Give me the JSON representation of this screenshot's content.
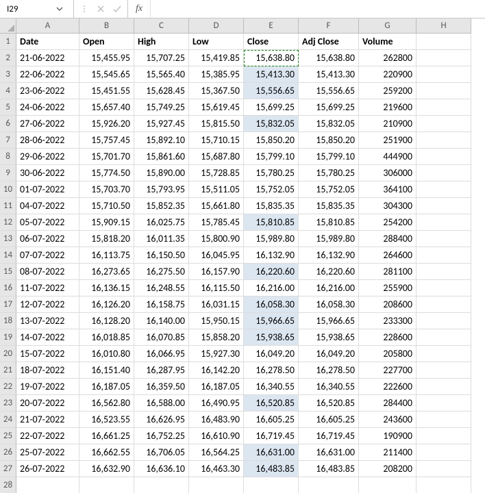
{
  "formula_bar": {
    "name_box_value": "I29",
    "fx_label": "fx",
    "formula_value": ""
  },
  "columns": [
    "A",
    "B",
    "C",
    "D",
    "E",
    "F",
    "G",
    "H"
  ],
  "row_numbers": [
    "1",
    "2",
    "3",
    "4",
    "5",
    "6",
    "7",
    "8",
    "9",
    "10",
    "11",
    "12",
    "13",
    "14",
    "15",
    "16",
    "17",
    "18",
    "19",
    "20",
    "21",
    "22",
    "23",
    "24",
    "25",
    "26",
    "27",
    "28"
  ],
  "headers": [
    "Date",
    "Open",
    "High",
    "Low",
    "Close",
    "Adj Close",
    "Volume"
  ],
  "highlighted_close_rows": [
    2,
    3,
    5,
    11,
    14,
    16,
    17,
    18,
    22,
    25,
    26
  ],
  "copied_cell": {
    "row": 1,
    "col": 4
  },
  "data_rows": [
    {
      "date": "21-06-2022",
      "open": "15,455.95",
      "high": "15,707.25",
      "low": "15,419.85",
      "close": "15,638.80",
      "adj": "15,638.80",
      "vol": "262800"
    },
    {
      "date": "22-06-2022",
      "open": "15,545.65",
      "high": "15,565.40",
      "low": "15,385.95",
      "close": "15,413.30",
      "adj": "15,413.30",
      "vol": "220900"
    },
    {
      "date": "23-06-2022",
      "open": "15,451.55",
      "high": "15,628.45",
      "low": "15,367.50",
      "close": "15,556.65",
      "adj": "15,556.65",
      "vol": "259200"
    },
    {
      "date": "24-06-2022",
      "open": "15,657.40",
      "high": "15,749.25",
      "low": "15,619.45",
      "close": "15,699.25",
      "adj": "15,699.25",
      "vol": "219600"
    },
    {
      "date": "27-06-2022",
      "open": "15,926.20",
      "high": "15,927.45",
      "low": "15,815.50",
      "close": "15,832.05",
      "adj": "15,832.05",
      "vol": "210900"
    },
    {
      "date": "28-06-2022",
      "open": "15,757.45",
      "high": "15,892.10",
      "low": "15,710.15",
      "close": "15,850.20",
      "adj": "15,850.20",
      "vol": "251900"
    },
    {
      "date": "29-06-2022",
      "open": "15,701.70",
      "high": "15,861.60",
      "low": "15,687.80",
      "close": "15,799.10",
      "adj": "15,799.10",
      "vol": "444900"
    },
    {
      "date": "30-06-2022",
      "open": "15,774.50",
      "high": "15,890.00",
      "low": "15,728.85",
      "close": "15,780.25",
      "adj": "15,780.25",
      "vol": "306000"
    },
    {
      "date": "01-07-2022",
      "open": "15,703.70",
      "high": "15,793.95",
      "low": "15,511.05",
      "close": "15,752.05",
      "adj": "15,752.05",
      "vol": "364100"
    },
    {
      "date": "04-07-2022",
      "open": "15,710.50",
      "high": "15,852.35",
      "low": "15,661.80",
      "close": "15,835.35",
      "adj": "15,835.35",
      "vol": "304300"
    },
    {
      "date": "05-07-2022",
      "open": "15,909.15",
      "high": "16,025.75",
      "low": "15,785.45",
      "close": "15,810.85",
      "adj": "15,810.85",
      "vol": "254200"
    },
    {
      "date": "06-07-2022",
      "open": "15,818.20",
      "high": "16,011.35",
      "low": "15,800.90",
      "close": "15,989.80",
      "adj": "15,989.80",
      "vol": "288400"
    },
    {
      "date": "07-07-2022",
      "open": "16,113.75",
      "high": "16,150.50",
      "low": "16,045.95",
      "close": "16,132.90",
      "adj": "16,132.90",
      "vol": "264600"
    },
    {
      "date": "08-07-2022",
      "open": "16,273.65",
      "high": "16,275.50",
      "low": "16,157.90",
      "close": "16,220.60",
      "adj": "16,220.60",
      "vol": "281100"
    },
    {
      "date": "11-07-2022",
      "open": "16,136.15",
      "high": "16,248.55",
      "low": "16,115.50",
      "close": "16,216.00",
      "adj": "16,216.00",
      "vol": "255900"
    },
    {
      "date": "12-07-2022",
      "open": "16,126.20",
      "high": "16,158.75",
      "low": "16,031.15",
      "close": "16,058.30",
      "adj": "16,058.30",
      "vol": "208600"
    },
    {
      "date": "13-07-2022",
      "open": "16,128.20",
      "high": "16,140.00",
      "low": "15,950.15",
      "close": "15,966.65",
      "adj": "15,966.65",
      "vol": "233300"
    },
    {
      "date": "14-07-2022",
      "open": "16,018.85",
      "high": "16,070.85",
      "low": "15,858.20",
      "close": "15,938.65",
      "adj": "15,938.65",
      "vol": "228600"
    },
    {
      "date": "15-07-2022",
      "open": "16,010.80",
      "high": "16,066.95",
      "low": "15,927.30",
      "close": "16,049.20",
      "adj": "16,049.20",
      "vol": "205800"
    },
    {
      "date": "18-07-2022",
      "open": "16,151.40",
      "high": "16,287.95",
      "low": "16,142.20",
      "close": "16,278.50",
      "adj": "16,278.50",
      "vol": "227700"
    },
    {
      "date": "19-07-2022",
      "open": "16,187.05",
      "high": "16,359.50",
      "low": "16,187.05",
      "close": "16,340.55",
      "adj": "16,340.55",
      "vol": "222600"
    },
    {
      "date": "20-07-2022",
      "open": "16,562.80",
      "high": "16,588.00",
      "low": "16,490.95",
      "close": "16,520.85",
      "adj": "16,520.85",
      "vol": "284400"
    },
    {
      "date": "21-07-2022",
      "open": "16,523.55",
      "high": "16,626.95",
      "low": "16,483.90",
      "close": "16,605.25",
      "adj": "16,605.25",
      "vol": "243600"
    },
    {
      "date": "22-07-2022",
      "open": "16,661.25",
      "high": "16,752.25",
      "low": "16,610.90",
      "close": "16,719.45",
      "adj": "16,719.45",
      "vol": "190900"
    },
    {
      "date": "25-07-2022",
      "open": "16,662.55",
      "high": "16,706.05",
      "low": "16,564.25",
      "close": "16,631.00",
      "adj": "16,631.00",
      "vol": "211400"
    },
    {
      "date": "26-07-2022",
      "open": "16,632.90",
      "high": "16,636.10",
      "low": "16,463.30",
      "close": "16,483.85",
      "adj": "16,483.85",
      "vol": "208200"
    }
  ]
}
